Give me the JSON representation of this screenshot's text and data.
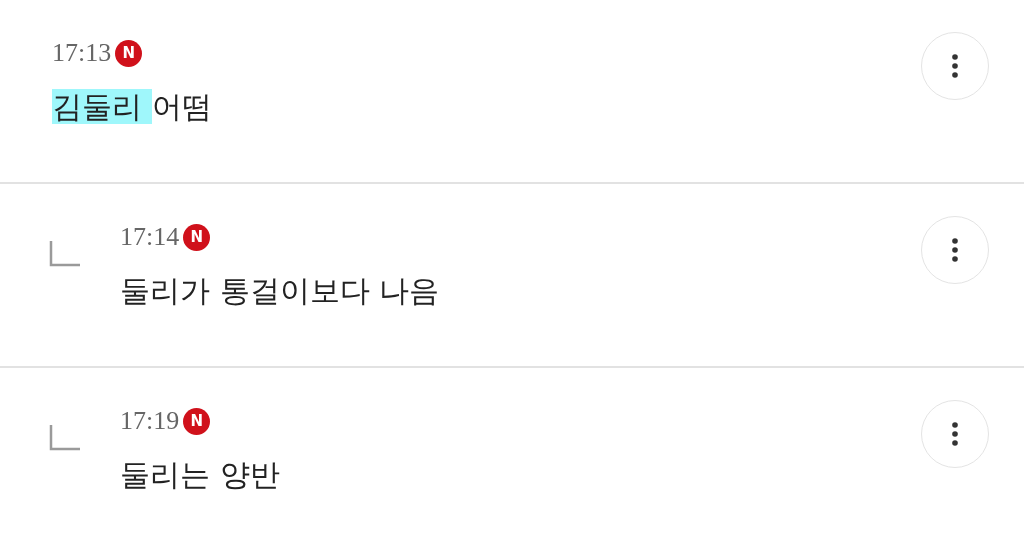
{
  "comments": [
    {
      "kind": "comment",
      "time": "17:13",
      "badge": "N",
      "segments": [
        {
          "text": "김둘리 ",
          "highlighted": true
        },
        {
          "text": "어떰",
          "highlighted": false
        }
      ]
    },
    {
      "kind": "reply",
      "time": "17:14",
      "badge": "N",
      "segments": [
        {
          "text": "둘리가 통걸이보다 나음",
          "highlighted": false
        }
      ]
    },
    {
      "kind": "reply",
      "time": "17:19",
      "badge": "N",
      "segments": [
        {
          "text": "둘리는 양반",
          "highlighted": false
        }
      ]
    }
  ]
}
